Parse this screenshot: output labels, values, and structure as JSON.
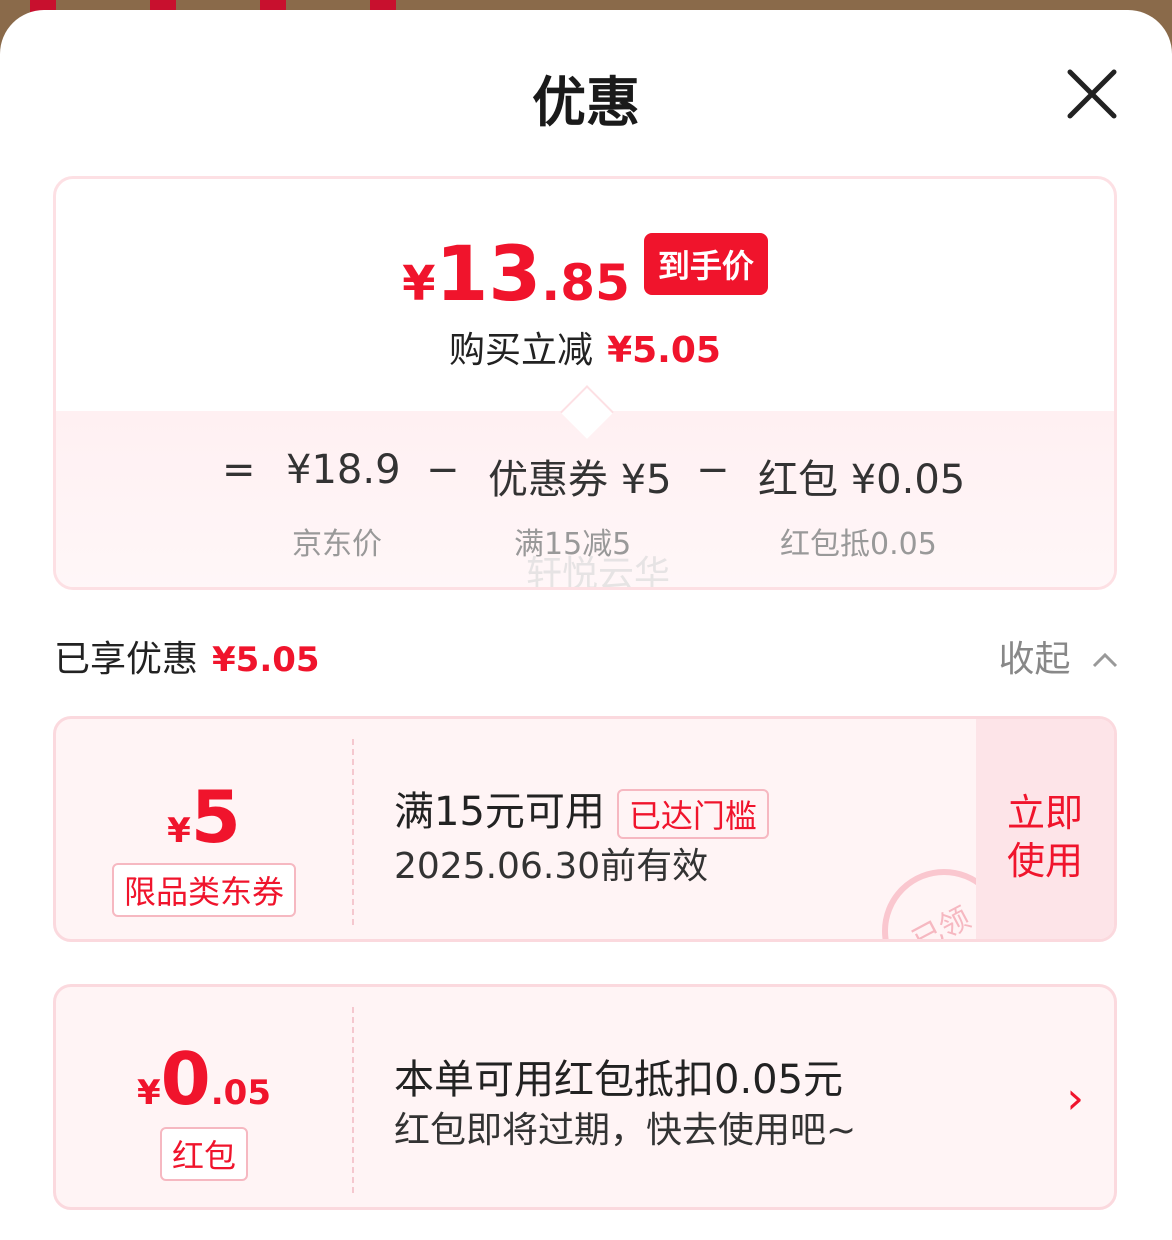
{
  "header": {
    "title": "优惠"
  },
  "summary": {
    "currency": "¥",
    "price_int": "13",
    "price_dec": ".85",
    "price_badge": "到手价",
    "reduce_label": "购买立减",
    "reduce_amount": "¥5.05",
    "formula": {
      "eq": "=",
      "jd_price": "¥18.9",
      "minus1": "−",
      "coupon": "优惠券 ¥5",
      "minus2": "−",
      "redpacket": "红包 ¥0.05"
    },
    "labels": {
      "jd_price": "京东价",
      "coupon": "满15减5",
      "redpacket": "红包抵0.05"
    },
    "watermark": "轩悦云华"
  },
  "enjoyed": {
    "label": "已享优惠",
    "amount": "¥5.05",
    "collapse_label": "收起"
  },
  "coupons": [
    {
      "currency": "¥",
      "value": "5",
      "tag": "限品类东券",
      "title": "满15元可用",
      "threshold_tag": "已达门槛",
      "subtitle": "2025.06.30前有效",
      "action_line1": "立即",
      "action_line2": "使用",
      "stamp": "已领"
    },
    {
      "currency": "¥",
      "value_int": "0",
      "value_dec": ".05",
      "tag": "红包",
      "title": "本单可用红包抵扣0.05元",
      "subtitle": "红包即将过期，快去使用吧~",
      "arrow": "›"
    }
  ],
  "colors": {
    "accent": "#f0142c",
    "card_bg": "#fff4f5",
    "border": "#fbd9de"
  },
  "icons": {
    "close": "close-icon",
    "collapse": "chevron-up-icon",
    "arrow": "chevron-right-icon"
  }
}
